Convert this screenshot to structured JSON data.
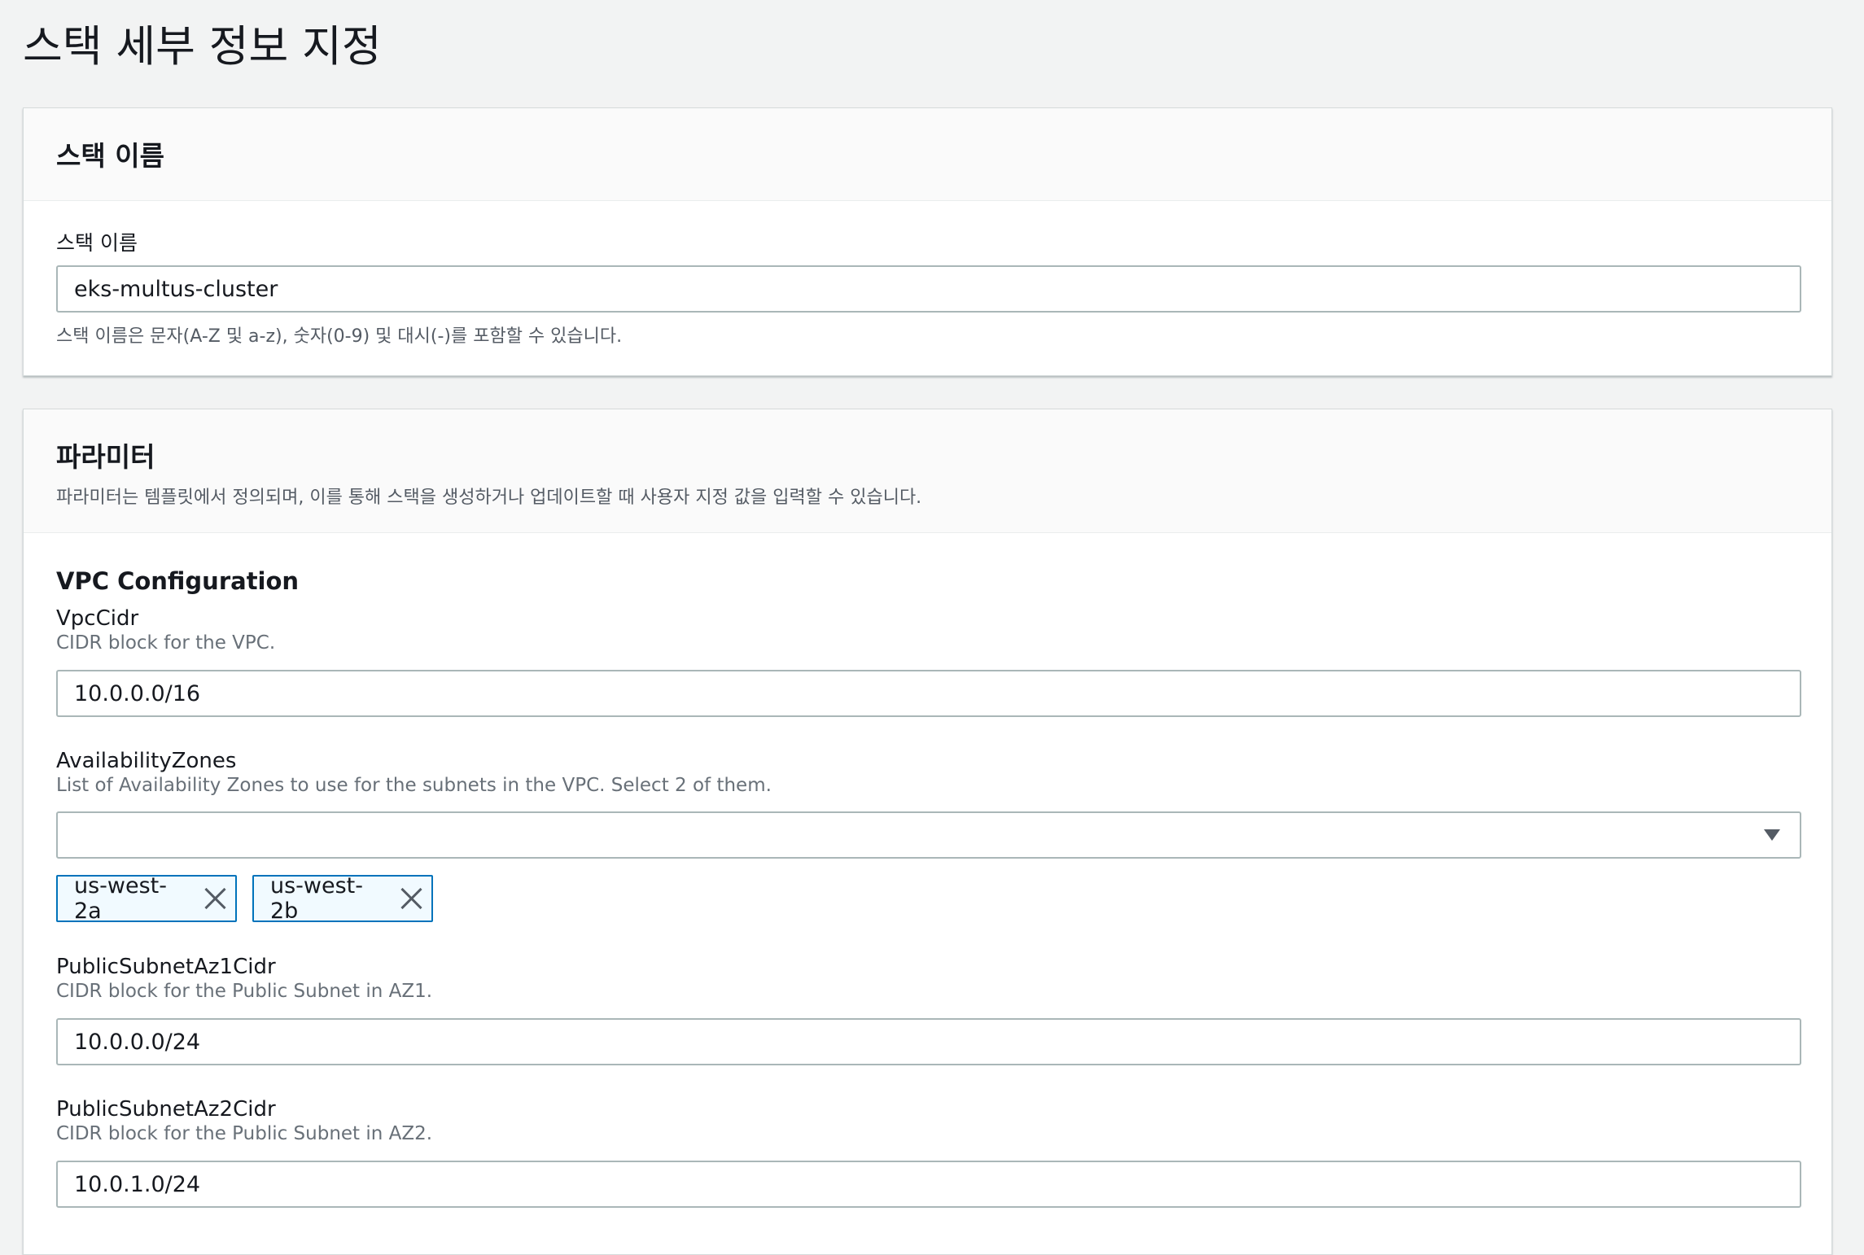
{
  "page": {
    "title": "스택 세부 정보 지정"
  },
  "stack_name_panel": {
    "header": "스택 이름",
    "label": "스택 이름",
    "value": "eks-multus-cluster",
    "help": "스택 이름은 문자(A-Z 및 a-z), 숫자(0-9) 및 대시(-)를 포함할 수 있습니다."
  },
  "parameters_panel": {
    "header": "파라미터",
    "description": "파라미터는 템플릿에서 정의되며, 이를 통해 스택을 생성하거나 업데이트할 때 사용자 지정 값을 입력할 수 있습니다.",
    "section_title": "VPC Configuration",
    "fields": [
      {
        "label": "VpcCidr",
        "desc": "CIDR block for the VPC.",
        "value": "10.0.0.0/16"
      },
      {
        "label": "AvailabilityZones",
        "desc": "List of Availability Zones to use for the subnets in the VPC. Select 2 of them.",
        "value": ""
      },
      {
        "label": "PublicSubnetAz1Cidr",
        "desc": "CIDR block for the Public Subnet in AZ1.",
        "value": "10.0.0.0/24"
      },
      {
        "label": "PublicSubnetAz2Cidr",
        "desc": "CIDR block for the Public Subnet in AZ2.",
        "value": "10.0.1.0/24"
      }
    ],
    "az_tokens": [
      {
        "label": "us-west-2a"
      },
      {
        "label": "us-west-2b"
      }
    ]
  },
  "colors": {
    "background": "#f2f3f3",
    "token_border": "#0073bb",
    "token_bg": "#f1faff",
    "input_border": "#aab7b8"
  }
}
